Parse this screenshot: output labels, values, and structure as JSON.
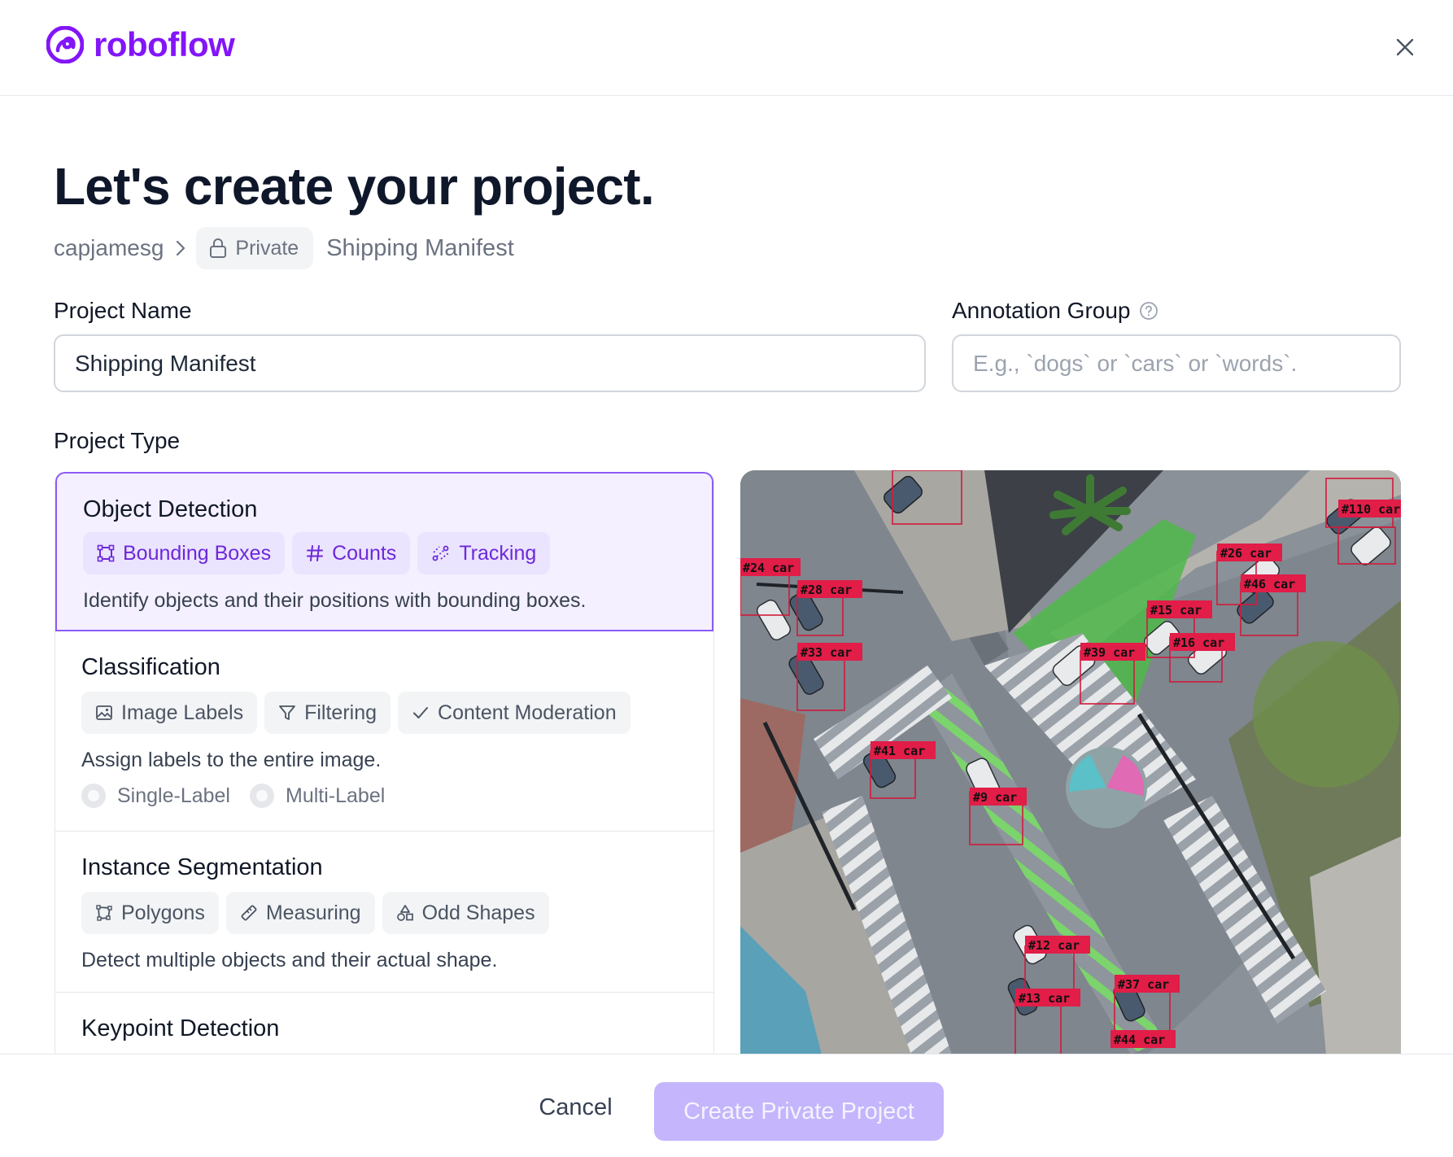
{
  "brand": {
    "name": "roboflow",
    "color": "#8315f9",
    "icon": "roboflow-logo-icon"
  },
  "header": {
    "close_icon": "close-icon"
  },
  "page_title": "Let's create your project.",
  "breadcrumb": {
    "workspace": "capjamesg",
    "visibility": "Private",
    "visibility_icon": "lock-icon",
    "project": "Shipping Manifest"
  },
  "form": {
    "project_name_label": "Project Name",
    "project_name_value": "Shipping Manifest",
    "annotation_group_label": "Annotation Group",
    "annotation_group_placeholder": "E.g., `dogs` or `cars` or `words`.",
    "annotation_group_help_icon": "help-circle-icon",
    "project_type_label": "Project Type"
  },
  "project_types": [
    {
      "title": "Object Detection",
      "selected": true,
      "chips": [
        {
          "label": "Bounding Boxes",
          "icon": "bounding-box-icon"
        },
        {
          "label": "Counts",
          "icon": "hash-icon"
        },
        {
          "label": "Tracking",
          "icon": "tracking-icon"
        }
      ],
      "description": "Identify objects and their positions with bounding boxes."
    },
    {
      "title": "Classification",
      "selected": false,
      "chips": [
        {
          "label": "Image Labels",
          "icon": "image-icon"
        },
        {
          "label": "Filtering",
          "icon": "filter-icon"
        },
        {
          "label": "Content Moderation",
          "icon": "check-icon"
        }
      ],
      "description": "Assign labels to the entire image.",
      "options": [
        "Single-Label",
        "Multi-Label"
      ]
    },
    {
      "title": "Instance Segmentation",
      "selected": false,
      "chips": [
        {
          "label": "Polygons",
          "icon": "polygon-icon"
        },
        {
          "label": "Measuring",
          "icon": "ruler-icon"
        },
        {
          "label": "Odd Shapes",
          "icon": "shapes-icon"
        }
      ],
      "description": "Detect multiple objects and their actual shape."
    },
    {
      "title": "Keypoint Detection",
      "selected": false
    }
  ],
  "preview": {
    "detections": [
      "#110 car",
      "#26 car",
      "#46 car",
      "#15 car",
      "#16 car",
      "#39 car",
      "#24 car",
      "#28 car",
      "#33 car",
      "#41 car",
      "#9 car",
      "#12 car",
      "#13 car",
      "#37 car",
      "#44 car"
    ]
  },
  "footer": {
    "cancel_label": "Cancel",
    "create_label": "Create Private Project"
  },
  "colors": {
    "accent": "#8b5cf6",
    "selected_bg": "#f4f0ff",
    "button_disabled": "#c4b5fd",
    "box_red": "#e11d48"
  }
}
